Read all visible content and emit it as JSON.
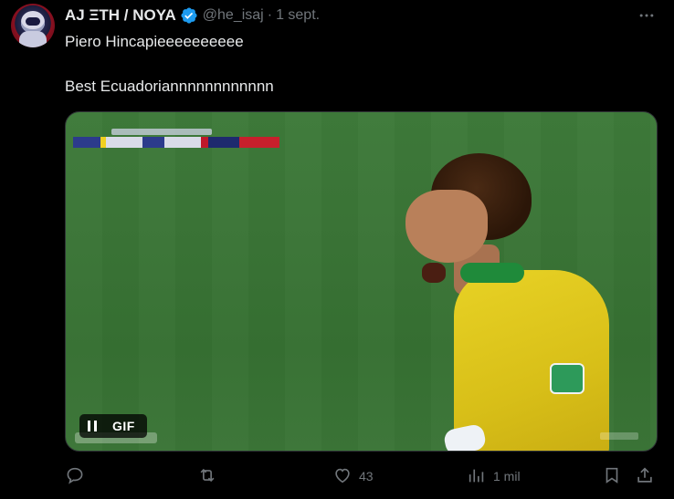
{
  "author": {
    "name": "AJ ΞTH / NOYA",
    "handle": "@he_isaj",
    "separator": "·",
    "time": "1 sept.",
    "verified": true
  },
  "post": {
    "line1": "Piero Hincapieeeeeeeeee",
    "line2": "Best Ecuadoriannnnnnnnnnnn"
  },
  "media": {
    "type": "gif",
    "badge_label": "GIF",
    "pause_icon": "pause-icon"
  },
  "actions": {
    "reply": {
      "icon": "reply-icon"
    },
    "repost": {
      "icon": "repost-icon"
    },
    "like": {
      "icon": "heart-icon",
      "count": "43"
    },
    "views": {
      "icon": "views-icon",
      "count": "1 mil"
    },
    "bookmark": {
      "icon": "bookmark-icon"
    },
    "share": {
      "icon": "share-icon"
    }
  },
  "colors": {
    "background": "#000000",
    "text": "#e7e9ea",
    "muted": "#71767b",
    "verified": "#1d9bf0"
  }
}
